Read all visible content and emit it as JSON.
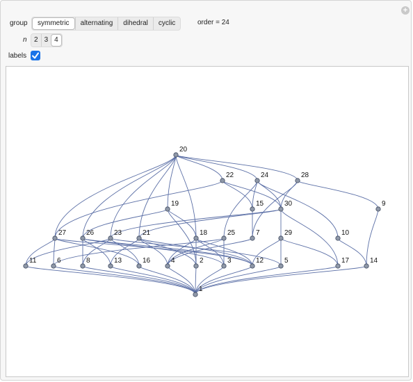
{
  "controls": {
    "group_label": "group",
    "group_options": [
      "symmetric",
      "alternating",
      "dihedral",
      "cyclic"
    ],
    "group_selected": "symmetric",
    "n_label": "n",
    "n_options": [
      "2",
      "3",
      "4"
    ],
    "n_selected": "4",
    "order_text": "order = 24",
    "labels_label": "labels",
    "labels_checked": true
  },
  "colors": {
    "edge": "#5b6fa6",
    "vertex_fill": "#8f98a8",
    "vertex_stroke": "#3f4a60",
    "accent": "#1a73e8"
  },
  "graph": {
    "vertices": [
      "20",
      "22",
      "24",
      "28",
      "19",
      "15",
      "30",
      "9",
      "27",
      "26",
      "23",
      "21",
      "18",
      "25",
      "7",
      "29",
      "10",
      "11",
      "6",
      "8",
      "13",
      "16",
      "4",
      "2",
      "3",
      "12",
      "5",
      "17",
      "14",
      "1"
    ],
    "edges": [
      [
        "20",
        "22"
      ],
      [
        "20",
        "24"
      ],
      [
        "20",
        "28"
      ],
      [
        "20",
        "19"
      ],
      [
        "20",
        "27"
      ],
      [
        "20",
        "26"
      ],
      [
        "20",
        "23"
      ],
      [
        "20",
        "21"
      ],
      [
        "20",
        "18"
      ],
      [
        "22",
        "15"
      ],
      [
        "22",
        "30"
      ],
      [
        "22",
        "27"
      ],
      [
        "24",
        "15"
      ],
      [
        "24",
        "30"
      ],
      [
        "24",
        "10"
      ],
      [
        "24",
        "25"
      ],
      [
        "28",
        "30"
      ],
      [
        "28",
        "9"
      ],
      [
        "28",
        "7"
      ],
      [
        "19",
        "26"
      ],
      [
        "19",
        "18"
      ],
      [
        "19",
        "2"
      ],
      [
        "15",
        "7"
      ],
      [
        "30",
        "23"
      ],
      [
        "30",
        "29"
      ],
      [
        "30",
        "17"
      ],
      [
        "30",
        "21"
      ],
      [
        "9",
        "14"
      ],
      [
        "10",
        "14"
      ],
      [
        "27",
        "6"
      ],
      [
        "27",
        "11"
      ],
      [
        "27",
        "16"
      ],
      [
        "27",
        "12"
      ],
      [
        "26",
        "8"
      ],
      [
        "26",
        "13"
      ],
      [
        "26",
        "3"
      ],
      [
        "26",
        "12"
      ],
      [
        "23",
        "16"
      ],
      [
        "23",
        "11"
      ],
      [
        "23",
        "8"
      ],
      [
        "23",
        "5"
      ],
      [
        "21",
        "13"
      ],
      [
        "21",
        "12"
      ],
      [
        "21",
        "4"
      ],
      [
        "21",
        "2"
      ],
      [
        "18",
        "4"
      ],
      [
        "18",
        "3"
      ],
      [
        "18",
        "2"
      ],
      [
        "18",
        "12"
      ],
      [
        "25",
        "6"
      ],
      [
        "25",
        "4"
      ],
      [
        "25",
        "3"
      ],
      [
        "7",
        "4"
      ],
      [
        "29",
        "12"
      ],
      [
        "29",
        "5"
      ],
      [
        "29",
        "17"
      ],
      [
        "1",
        "11"
      ],
      [
        "1",
        "6"
      ],
      [
        "1",
        "8"
      ],
      [
        "1",
        "13"
      ],
      [
        "1",
        "16"
      ],
      [
        "1",
        "4"
      ],
      [
        "1",
        "2"
      ],
      [
        "1",
        "3"
      ],
      [
        "1",
        "12"
      ],
      [
        "1",
        "5"
      ],
      [
        "1",
        "17"
      ],
      [
        "1",
        "14"
      ]
    ]
  }
}
